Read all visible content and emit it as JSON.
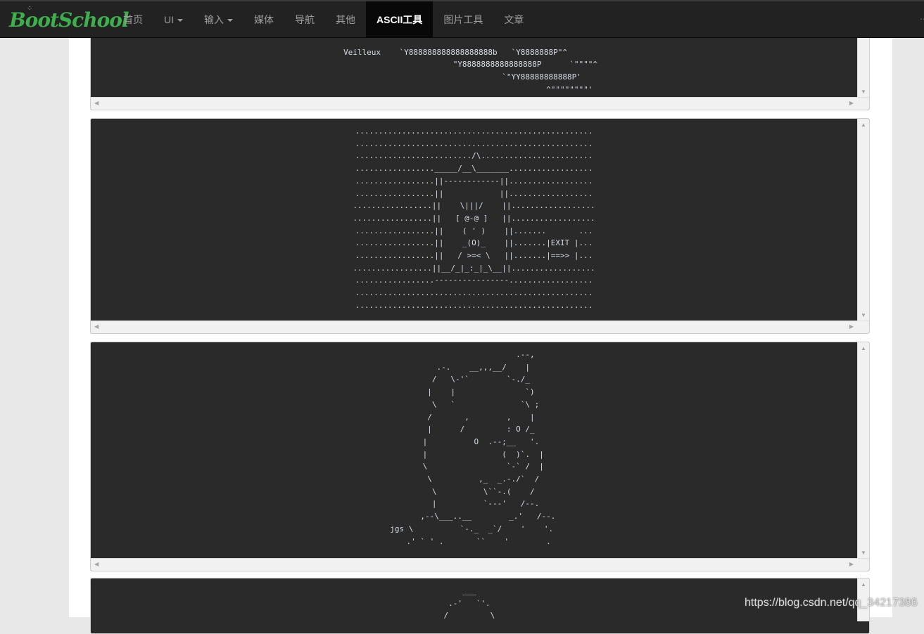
{
  "brand": {
    "name": "BootSchool"
  },
  "nav": [
    {
      "label": "首页",
      "dropdown": false,
      "active": false
    },
    {
      "label": "UI",
      "dropdown": true,
      "active": false
    },
    {
      "label": "输入",
      "dropdown": true,
      "active": false
    },
    {
      "label": "媒体",
      "dropdown": false,
      "active": false
    },
    {
      "label": "导航",
      "dropdown": false,
      "active": false
    },
    {
      "label": "其他",
      "dropdown": false,
      "active": false
    },
    {
      "label": "ASCII工具",
      "dropdown": false,
      "active": true
    },
    {
      "label": "图片工具",
      "dropdown": false,
      "active": false
    },
    {
      "label": "文章",
      "dropdown": false,
      "active": false
    }
  ],
  "ascii_panels": [
    {
      "art": "                                                        \nVeilleux    `Y888888888888888888b   `Y8888888P\"^        \n                        \"Y8888888888888888P      `\"\"\"\"^  \n                                   `\"YY88888888888P'      \n                                            ^\"\"\"\"\"\"\"\"'   "
    },
    {
      "art": "...................................................\n...................................................\n........................./\\........................\n................._____/__\\_______..................\n.................||------------||..................\n.................||            ||..................\n.................||    \\|||/    ||..................\n.................||   [ @-@ ]   ||..................\n.................||    ( ' )    ||.......       ...\n.................||    _(O)_    ||.......|EXIT |...\n.................||   / >=< \\   ||.......|==>> |...\n.................||__/_|_:_|_\\__||..................\n.................----------------..................\n...................................................\n..................................................."
    },
    {
      "art": "                           .--,     \n          .-.    __,,,__/    |      \n         /   \\-'`        `-./_      \n        |    |               `)     \n         \\   `              `\\ ;    \n        /       ,        ,    |     \n        |      /         : O /_     \n       |          O  .--;__   '.    \n       |                (  )`.  |   \n       \\                 `-` /  |   \n        \\          ,_  _.-./`  /    \n         \\          \\``-.(    /     \n         |          `---'   /--.    \n       ,--\\___..__        _.'   /--. \njgs \\          `-._  _`/    '    '. \n    .' ` ' .       ``    '        .  "
    },
    {
      "art": "     ___       \n  .-'   `'.    \n /         \\   "
    }
  ],
  "watermark": "https://blog.csdn.net/qq_34217386"
}
